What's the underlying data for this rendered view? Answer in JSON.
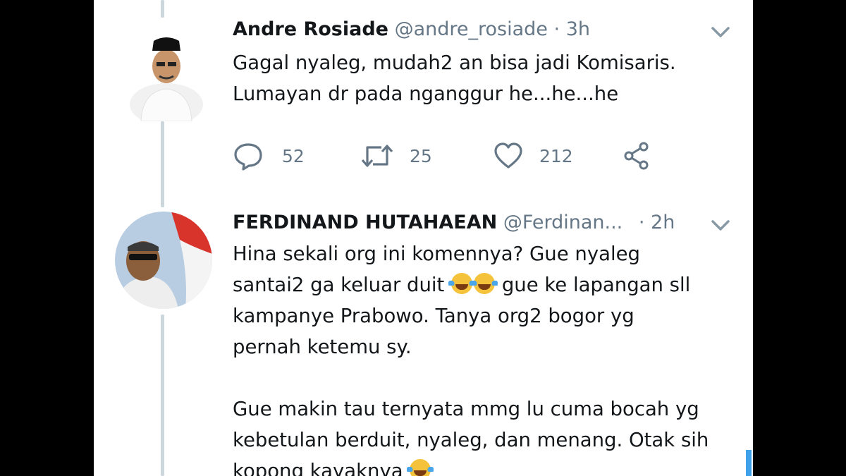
{
  "tweet1": {
    "name": "Andre Rosiade",
    "handle": "@andre_rosiade",
    "separator": "·",
    "time": "3h",
    "lines": [
      "Gagal nyaleg, mudah2 an bisa jadi Komisaris.",
      "Lumayan dr pada nganggur he...he...he"
    ],
    "reply_count": "52",
    "retweet_count": "25",
    "like_count": "212"
  },
  "tweet2": {
    "name": "FERDINAND HUTAHAEAN",
    "handle": "@Ferdinan...",
    "separator": "·",
    "time": "2h",
    "line1": "Hina sekali org ini komennya? Gue nyaleg",
    "line2_a": "santai2 ga keluar duit",
    "line2_b": "gue ke lapangan sll",
    "line3": "kampanye Prabowo. Tanya org2 bogor yg",
    "line4": "pernah ketemu sy.",
    "line5": "Gue makin tau ternyata mmg lu cuma bocah yg",
    "line6": "kebetulan berduit, nyaleg, dan menang. Otak sih",
    "line7": "kopong kayaknya"
  },
  "colors": {
    "text": "#14171a",
    "secondary": "#657786",
    "thread": "#ccd6dd",
    "accent": "#3ea1e9"
  }
}
